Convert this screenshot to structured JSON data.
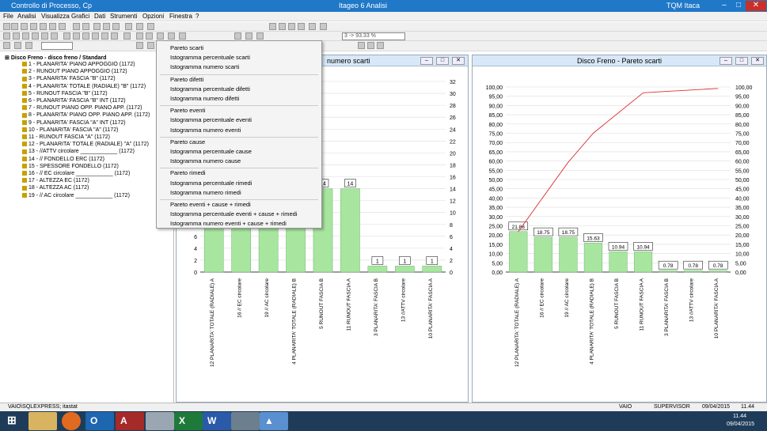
{
  "app": {
    "title": "Controllo di Processo, Cp",
    "center_title": "Itageo 6 Analisi",
    "right_title": "TQM Itaca"
  },
  "menu": [
    "File",
    "Analisi",
    "Visualizza",
    "Grafici",
    "Dati",
    "Strumenti",
    "Opzioni",
    "Finestra",
    "?"
  ],
  "toolbar": {
    "combo_value": "3 -> 93.33 %"
  },
  "tree": {
    "root": "Disco Freno - disco freno / Standard",
    "items": [
      "1 - PLANARITA' PIANO APPOGGIO (1172)",
      "2 - RUNOUT PIANO APPOGGIO (1172)",
      "3 - PLANARITA' FASCIA \"B\" (1172)",
      "4 - PLANARITA' TOTALE (RADIALE) \"B\" (1172)",
      "5 - RUNOUT FASCIA \"B\" (1172)",
      "6 - PLANARITA' FASCIA \"B\" INT (1172)",
      "7 - RUNOUT PIANO OPP. PIANO APP. (1172)",
      "8 - PLANARITA' PIANO OPP. PIANO APP. (1172)",
      "9 - PLANARITA' FASCIA \"A\" INT (1172)",
      "10 - PLANARITA' FASCIA \"A\" (1172)",
      "11 - RUNOUT FASCIA \"A\" (1172)",
      "12 - PLANARITA' TOTALE (RADIALE) \"A\" (1172)",
      "13 - //ATTV circolare ____________ (1172)",
      "14 - // FONDELLO ERC (1172)",
      "15 - SPESSORE FONDELLO (1172)",
      "16 - // EC circolare ____________ (1172)",
      "17 - ALTEZZA EC (1172)",
      "18 - ALTEZZA AC (1172)",
      "19 - // AC circolare ____________ (1172)"
    ]
  },
  "dropdown": {
    "groups": [
      [
        "Pareto scarti",
        "Istogramma percentuale scarti",
        "Istogramma numero scarti"
      ],
      [
        "Pareto difetti",
        "Istogramma percentuale difetti",
        "Istogramma numero difetti"
      ],
      [
        "Pareto eventi",
        "Istogramma percentuale eventi",
        "Istogramma numero eventi"
      ],
      [
        "Pareto cause",
        "Istogramma percentuale cause",
        "Istogramma numero cause"
      ],
      [
        "Pareto rimedi",
        "Istogramma percentuale rimedi",
        "Istogramma numero rimedi"
      ],
      [
        "Pareto eventi + cause + rimedi",
        "Istogramma percentuale eventi + cause + rimedi",
        "Istogramma numero eventi + cause + rimedi"
      ]
    ]
  },
  "left_chart": {
    "title_visible": "numero scarti",
    "type": "bar",
    "yticks": [
      0,
      2,
      4,
      6,
      8,
      10,
      12,
      14,
      16,
      18,
      20,
      22,
      24,
      26,
      28,
      30,
      32
    ],
    "categories": [
      "12 PLANARITA' TOTALE (RADIALE) A",
      "16 // EC circolare",
      "19 // AC circolare",
      "4 PLANARITA' TOTALE (RADIALE) B",
      "5 RUNOUT FASCIA B",
      "11 RUNOUT FASCIA A",
      "3 PLANARITA' FASCIA B",
      "13 //ATTV circolare",
      "10 PLANARITA' FASCIA A"
    ],
    "values": [
      28,
      24,
      24,
      20,
      14,
      14,
      1,
      1,
      1
    ],
    "labels": [
      "",
      "",
      "",
      "",
      "14",
      "14",
      "1",
      "1",
      "1"
    ],
    "ylim": [
      0,
      32
    ]
  },
  "chart_data": {
    "type": "bar",
    "title": "Disco Freno - Pareto scarti",
    "categories": [
      "12 PLANARITA' TOTALE (RADIALE) A",
      "16 // EC circolare",
      "19 // AC circolare",
      "4 PLANARITA' TOTALE (RADIALE) B",
      "5 RUNOUT FASCIA B",
      "11 RUNOUT FASCIA A",
      "3 PLANARITA' FASCIA B",
      "13 //ATTV circolare",
      "10 PLANARITA' FASCIA A"
    ],
    "values": [
      21.88,
      18.75,
      18.75,
      15.63,
      10.94,
      10.94,
      0.78,
      0.78,
      0.78
    ],
    "labels": [
      "21.88",
      "18.75",
      "18.75",
      "15.63",
      "10.94",
      "10.94",
      "0.78",
      "0.78",
      "0.78"
    ],
    "cumulative": [
      21.88,
      40.63,
      59.38,
      75.0,
      85.94,
      96.88,
      97.66,
      98.44,
      99.22
    ],
    "yticks": [
      "100,00",
      "95,00",
      "90,00",
      "85,00",
      "80,00",
      "75,00",
      "70,00",
      "65,00",
      "60,00",
      "55,00",
      "50,00",
      "45,00",
      "40,00",
      "35,00",
      "30,00",
      "25,00",
      "20,00",
      "15,00",
      "10,00",
      "5,00",
      "0,00"
    ],
    "ylim": [
      0,
      100
    ],
    "colors": {
      "bar": "#a8e6a0",
      "line": "#e03030"
    }
  },
  "status": {
    "left": "VAIO\\SQLEXPRESS; itastat",
    "user": "VAIO",
    "role": "SUPERVISOR",
    "date": "09/04/2015",
    "time": "11.44"
  },
  "taskbar": {
    "clock_time": "11.44",
    "clock_date": "09/04/2015"
  }
}
